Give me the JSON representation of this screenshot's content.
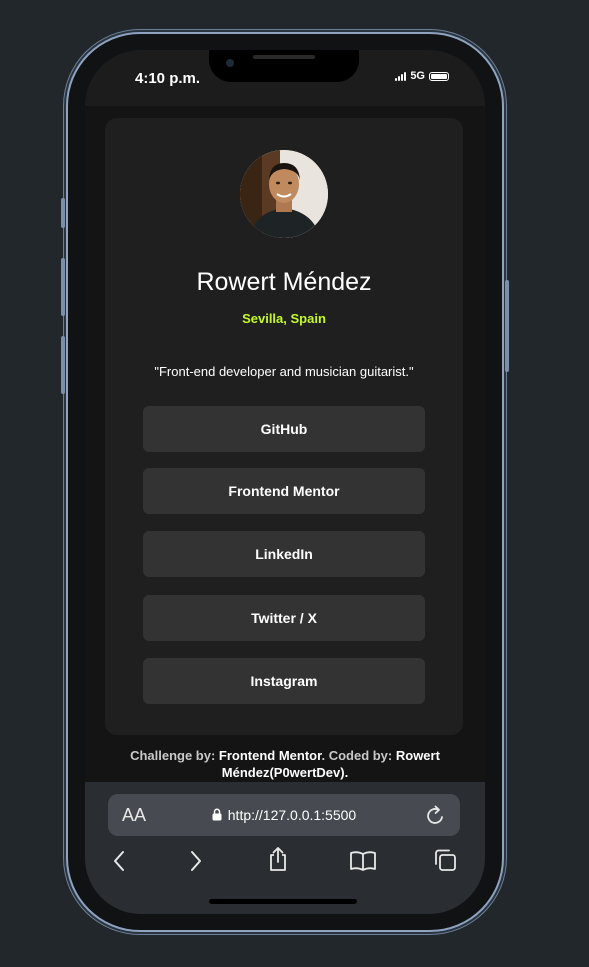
{
  "status_bar": {
    "time": "4:10 p.m.",
    "network": "5G"
  },
  "profile": {
    "name": "Rowert Méndez",
    "location": "Sevilla, Spain",
    "bio": "\"Front-end developer and musician guitarist.\"",
    "links": [
      {
        "label": "GitHub"
      },
      {
        "label": "Frontend Mentor"
      },
      {
        "label": "LinkedIn"
      },
      {
        "label": "Twitter / X"
      },
      {
        "label": "Instagram"
      }
    ]
  },
  "footer": {
    "challenge_prefix": "Challenge by: ",
    "challenge_link": "Frontend Mentor",
    "coded_prefix": ". Coded by: ",
    "coded_link": "Rowert Méndez(P0wertDev)",
    "suffix": "."
  },
  "browser": {
    "text_size_label": "AA",
    "url": "http://127.0.0.1:5500"
  },
  "colors": {
    "accent": "#c4f82a",
    "button_bg": "#333333",
    "card_bg": "#1f1f1f",
    "page_bg": "#22272b"
  },
  "icons": {
    "lock": "lock-icon",
    "reload": "reload-icon",
    "back": "chevron-left-icon",
    "forward": "chevron-right-icon",
    "share": "share-icon",
    "bookmarks": "book-icon",
    "tabs": "tabs-icon"
  }
}
